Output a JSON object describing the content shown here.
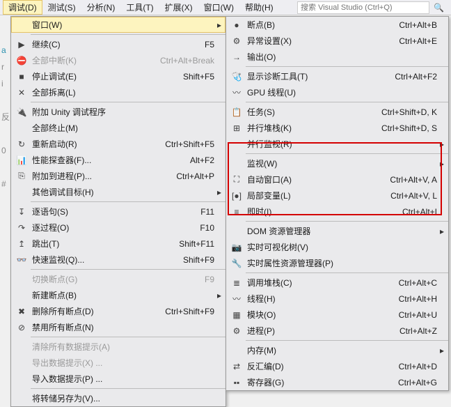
{
  "menubar": {
    "items": [
      "调试(D)",
      "测试(S)",
      "分析(N)",
      "工具(T)",
      "扩展(X)",
      "窗口(W)",
      "帮助(H)"
    ],
    "search_placeholder": "搜索 Visual Studio (Ctrl+Q)"
  },
  "menu1": [
    {
      "icon": "",
      "label": "窗口(W)",
      "shortcut": "",
      "sub": true,
      "hover": true
    },
    {
      "sep": true
    },
    {
      "icon": "▶",
      "label": "继续(C)",
      "shortcut": "F5"
    },
    {
      "icon": "⛔",
      "label": "全部中断(K)",
      "shortcut": "Ctrl+Alt+Break",
      "disabled": true
    },
    {
      "icon": "■",
      "label": "停止调试(E)",
      "shortcut": "Shift+F5"
    },
    {
      "icon": "✕",
      "label": "全部拆离(L)",
      "shortcut": ""
    },
    {
      "sep": true
    },
    {
      "icon": "🔌",
      "label": "附加 Unity 调试程序",
      "shortcut": ""
    },
    {
      "icon": "",
      "label": "全部终止(M)",
      "shortcut": ""
    },
    {
      "icon": "↻",
      "label": "重新启动(R)",
      "shortcut": "Ctrl+Shift+F5"
    },
    {
      "icon": "📊",
      "label": "性能探查器(F)...",
      "shortcut": "Alt+F2"
    },
    {
      "icon": "⎘",
      "label": "附加到进程(P)...",
      "shortcut": "Ctrl+Alt+P"
    },
    {
      "icon": "",
      "label": "其他调试目标(H)",
      "shortcut": "",
      "sub": true
    },
    {
      "sep": true
    },
    {
      "icon": "↧",
      "label": "逐语句(S)",
      "shortcut": "F11"
    },
    {
      "icon": "↷",
      "label": "逐过程(O)",
      "shortcut": "F10"
    },
    {
      "icon": "↥",
      "label": "跳出(T)",
      "shortcut": "Shift+F11"
    },
    {
      "icon": "👓",
      "label": "快速监视(Q)...",
      "shortcut": "Shift+F9"
    },
    {
      "sep": true
    },
    {
      "icon": "",
      "label": "切换断点(G)",
      "shortcut": "F9",
      "disabled": true
    },
    {
      "icon": "",
      "label": "新建断点(B)",
      "shortcut": "",
      "sub": true
    },
    {
      "icon": "✖",
      "label": "删除所有断点(D)",
      "shortcut": "Ctrl+Shift+F9"
    },
    {
      "icon": "⊘",
      "label": "禁用所有断点(N)",
      "shortcut": ""
    },
    {
      "sep": true
    },
    {
      "icon": "",
      "label": "清除所有数据提示(A)",
      "shortcut": "",
      "disabled": true
    },
    {
      "icon": "",
      "label": "导出数据提示(X) ...",
      "shortcut": "",
      "disabled": true
    },
    {
      "icon": "",
      "label": "导入数据提示(P) ...",
      "shortcut": ""
    },
    {
      "sep": true
    },
    {
      "icon": "",
      "label": "将转储另存为(V)...",
      "shortcut": ""
    }
  ],
  "menu2": [
    {
      "icon": "●",
      "label": "断点(B)",
      "shortcut": "Ctrl+Alt+B"
    },
    {
      "icon": "⚙",
      "label": "异常设置(X)",
      "shortcut": "Ctrl+Alt+E"
    },
    {
      "icon": "→",
      "label": "输出(O)",
      "shortcut": ""
    },
    {
      "sep": true
    },
    {
      "icon": "🩺",
      "label": "显示诊断工具(T)",
      "shortcut": "Ctrl+Alt+F2"
    },
    {
      "icon": "〰",
      "label": "GPU 线程(U)",
      "shortcut": ""
    },
    {
      "sep": true
    },
    {
      "icon": "📋",
      "label": "任务(S)",
      "shortcut": "Ctrl+Shift+D, K"
    },
    {
      "icon": "⊞",
      "label": "并行堆栈(K)",
      "shortcut": "Ctrl+Shift+D, S"
    },
    {
      "icon": "",
      "label": "并行监视(R)",
      "shortcut": "",
      "sub": true
    },
    {
      "sep": true
    },
    {
      "icon": "",
      "label": "监视(W)",
      "shortcut": "",
      "sub": true
    },
    {
      "icon": "⛶",
      "label": "自动窗口(A)",
      "shortcut": "Ctrl+Alt+V, A"
    },
    {
      "icon": "[●]",
      "label": "局部变量(L)",
      "shortcut": "Ctrl+Alt+V, L"
    },
    {
      "icon": "≡",
      "label": "即时(I)",
      "shortcut": "Ctrl+Alt+I"
    },
    {
      "sep": true
    },
    {
      "icon": "",
      "label": "DOM 资源管理器",
      "shortcut": "",
      "sub": true
    },
    {
      "icon": "📷",
      "label": "实时可视化树(V)",
      "shortcut": ""
    },
    {
      "icon": "🔧",
      "label": "实时属性资源管理器(P)",
      "shortcut": ""
    },
    {
      "sep": true
    },
    {
      "icon": "≣",
      "label": "调用堆栈(C)",
      "shortcut": "Ctrl+Alt+C"
    },
    {
      "icon": "〰",
      "label": "线程(H)",
      "shortcut": "Ctrl+Alt+H"
    },
    {
      "icon": "▦",
      "label": "模块(O)",
      "shortcut": "Ctrl+Alt+U"
    },
    {
      "icon": "⚙",
      "label": "进程(P)",
      "shortcut": "Ctrl+Alt+Z"
    },
    {
      "sep": true
    },
    {
      "icon": "",
      "label": "内存(M)",
      "shortcut": "",
      "sub": true
    },
    {
      "icon": "⇄",
      "label": "反汇编(D)",
      "shortcut": "Ctrl+Alt+D"
    },
    {
      "icon": "▪▪",
      "label": "寄存器(G)",
      "shortcut": "Ctrl+Alt+G"
    }
  ]
}
